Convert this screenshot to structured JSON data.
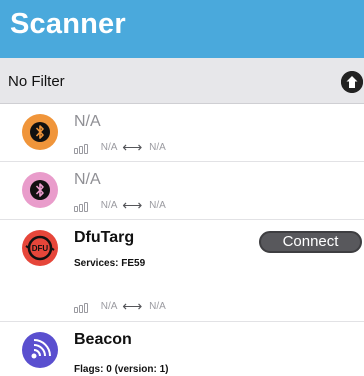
{
  "header": {
    "title": "Scanner"
  },
  "filter": {
    "label": "No Filter"
  },
  "icons": {
    "up_arrow": "arrow-up-circle-icon",
    "bluetooth": "bluetooth-icon",
    "dfu": "dfu-icon",
    "beacon": "beacon-icon",
    "signal": "signal-strength-icon",
    "bidirectional": "left-right-arrow-icon"
  },
  "colors": {
    "header_bg": "#4aa9dc",
    "device1": "#f0953a",
    "device2": "#e99ccb",
    "dfu": "#e6463a",
    "beacon": "#5a4fcf",
    "connect_bg": "#58585c"
  },
  "devices": [
    {
      "name": "N/A",
      "rssi": "N/A",
      "interval": "N/A"
    },
    {
      "name": "N/A",
      "rssi": "N/A",
      "interval": "N/A"
    },
    {
      "name": "DfuTarg",
      "services": "Services: FE59",
      "connect_label": "Connect",
      "rssi": "N/A",
      "interval": "N/A"
    },
    {
      "name": "Beacon",
      "flags": "Flags: 0 (version: 1)"
    }
  ]
}
